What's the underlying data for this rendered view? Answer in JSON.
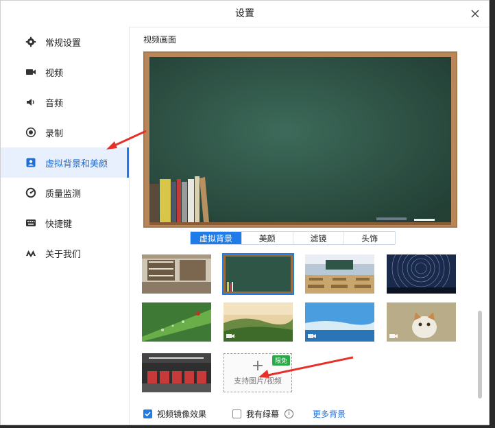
{
  "window": {
    "title": "设置"
  },
  "sidebar": {
    "items": [
      {
        "label": "常规设置",
        "icon": "gear-icon"
      },
      {
        "label": "视频",
        "icon": "video-camera-icon"
      },
      {
        "label": "音频",
        "icon": "speaker-icon"
      },
      {
        "label": "录制",
        "icon": "record-icon"
      },
      {
        "label": "虚拟背景和美颜",
        "icon": "portrait-icon",
        "active": true
      },
      {
        "label": "质量监测",
        "icon": "monitor-gauge-icon"
      },
      {
        "label": "快捷键",
        "icon": "keyboard-icon"
      },
      {
        "label": "关于我们",
        "icon": "logo-icon"
      }
    ]
  },
  "main": {
    "section_title": "视频画面",
    "tabs": [
      {
        "label": "虚拟背景",
        "active": true
      },
      {
        "label": "美颜"
      },
      {
        "label": "滤镜"
      },
      {
        "label": "头饰"
      }
    ],
    "backgrounds": [
      {
        "name": "bookshelf-room"
      },
      {
        "name": "chalkboard",
        "selected": true
      },
      {
        "name": "classroom"
      },
      {
        "name": "star-trails"
      },
      {
        "name": "leaf-ladybug"
      },
      {
        "name": "green-hills",
        "video": true
      },
      {
        "name": "sky-sea",
        "video": true
      },
      {
        "name": "kitten",
        "video": true
      },
      {
        "name": "sofas-room"
      }
    ],
    "upload": {
      "text": "支持图片/视频",
      "badge": "限免"
    },
    "footer": {
      "mirror_label": "视频镜像效果",
      "mirror_checked": true,
      "greenscreen_label": "我有绿幕",
      "greenscreen_checked": false,
      "more_label": "更多背景"
    }
  },
  "colors": {
    "accent": "#1e7ce8",
    "badge": "#2aa84a",
    "annotation_arrow": "#e8302a"
  }
}
